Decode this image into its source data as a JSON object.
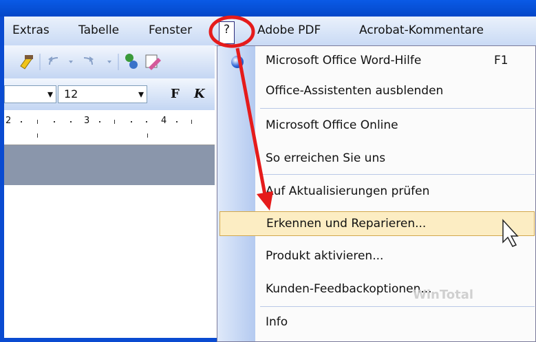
{
  "menubar": {
    "items": [
      {
        "label": "Extras"
      },
      {
        "label": "Tabelle"
      },
      {
        "label": "Fenster"
      },
      {
        "label": "?"
      },
      {
        "label": "Adobe PDF"
      },
      {
        "label": "Acrobat-Kommentare"
      }
    ]
  },
  "formatting": {
    "font_size": "12",
    "bold_label": "F",
    "italic_label": "K"
  },
  "ruler": {
    "marks": [
      "2",
      "3",
      "4"
    ]
  },
  "help_menu": {
    "items": [
      {
        "label": "Microsoft Office Word-Hilfe",
        "shortcut": "F1"
      },
      {
        "label": "Office-Assistenten ausblenden"
      },
      {
        "label": "Microsoft Office Online"
      },
      {
        "label": "So erreichen Sie uns"
      },
      {
        "label": "Auf Aktualisierungen prüfen"
      },
      {
        "label": "Erkennen und Reparieren..."
      },
      {
        "label": "Produkt aktivieren..."
      },
      {
        "label": "Kunden-Feedbackoptionen..."
      },
      {
        "label": "Info"
      }
    ]
  },
  "watermark": "WinTotal",
  "colors": {
    "highlight": "#fcedc3",
    "annotation": "#e51b1b",
    "menubar": "#dde8f9"
  }
}
